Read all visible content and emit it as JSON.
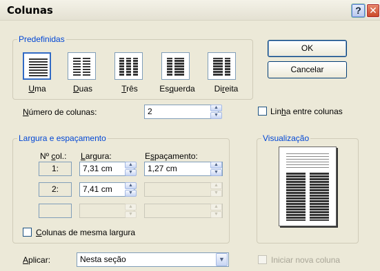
{
  "dialog": {
    "title": "Colunas"
  },
  "titlebar": {
    "help_glyph": "?",
    "close_glyph": "✕"
  },
  "presets": {
    "legend": "Predefinidas",
    "items": [
      {
        "label_u": "U",
        "label_rest": "ma",
        "selected": true
      },
      {
        "label_u": "D",
        "label_rest": "uas",
        "selected": false
      },
      {
        "label_u": "T",
        "label_rest": "rês",
        "selected": false
      },
      {
        "label_pre": "Es",
        "label_u": "q",
        "label_rest": "uerda",
        "selected": false
      },
      {
        "label_pre": "Di",
        "label_u": "r",
        "label_rest": "eita",
        "selected": false
      }
    ]
  },
  "buttons": {
    "ok": "OK",
    "cancel": "Cancelar"
  },
  "num_columns": {
    "label_u": "N",
    "label_rest": "úmero de colunas:",
    "value": "2"
  },
  "line_between": {
    "label_pre": "Lin",
    "label_u": "h",
    "label_rest": "a entre colunas",
    "checked": false
  },
  "width_spacing": {
    "legend": "Largura e espaçamento",
    "headers": {
      "col_pre": "Nº ",
      "col_u": "c",
      "col_rest": "ol.:",
      "width_u": "L",
      "width_rest": "argura:",
      "spacing_pre": "E",
      "spacing_u": "s",
      "spacing_rest": "paçamento:"
    },
    "rows": [
      {
        "col": "1:",
        "width": "7,31 cm",
        "spacing": "1,27 cm"
      },
      {
        "col": "2:",
        "width": "7,41 cm",
        "spacing": ""
      },
      {
        "col": "",
        "width": "",
        "spacing": ""
      }
    ],
    "equal_width": {
      "label_u": "C",
      "label_rest": "olunas de mesma largura",
      "checked": false
    }
  },
  "preview": {
    "legend": "Visualização"
  },
  "apply": {
    "label_u": "A",
    "label_rest": "plicar:",
    "value": "Nesta seção"
  },
  "start_new_column": {
    "label": "Iniciar nova coluna",
    "checked": false
  }
}
